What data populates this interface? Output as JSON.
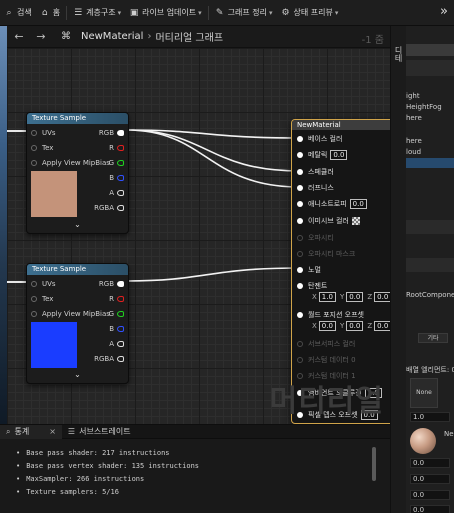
{
  "toolbar": {
    "search_label": "검색",
    "home_label": "홈",
    "hierarchy_label": "계층구조",
    "live_update_label": "라이브 업데이트",
    "graph_cleanup_label": "그래프 정리",
    "state_preview_label": "상태 프리뷰",
    "more_label": "»"
  },
  "graph_header": {
    "back_label": "←",
    "forward_label": "→",
    "material_name": "NewMaterial",
    "separator": "›",
    "graph_label": "머티리얼 그래프",
    "zoom_label": "-1 줌"
  },
  "texture_node_1": {
    "title": "Texture Sample",
    "inputs": [
      "UVs",
      "Tex",
      "Apply View MipBias"
    ],
    "outputs": [
      "RGB",
      "R",
      "G",
      "B",
      "A",
      "RGBA"
    ],
    "preview_color": "#c4937a"
  },
  "texture_node_2": {
    "title": "Texture Sample",
    "inputs": [
      "UVs",
      "Tex",
      "Apply View MipBias"
    ],
    "outputs": [
      "RGB",
      "R",
      "G",
      "B",
      "A",
      "RGBA"
    ],
    "preview_color": "#1a3dff"
  },
  "material_node": {
    "title": "NewMaterial",
    "base_color": "베이스 컬러",
    "metallic": "메탈릭",
    "metallic_value": "0.0",
    "specular": "스페큘러",
    "roughness": "러프니스",
    "anisotropy": "애니소트로피",
    "anisotropy_value": "0.0",
    "emissive": "이미시브 컬러",
    "opacity": "오파시티",
    "opacity_mask": "오파시티 마스크",
    "normal": "노멀",
    "tangent": "탄젠트",
    "tangent_x": "1.0",
    "tangent_y": "0.0",
    "tangent_z": "0.0",
    "wpo": "월드 포지션 오프셋",
    "wpo_x": "0.0",
    "wpo_y": "0.0",
    "wpo_z": "0.0",
    "subsurface": "서브서피스 컬러",
    "custom_data_0": "커스텀 데이터 0",
    "custom_data_1": "커스텀 데이터 1",
    "ambient_occlusion": "앰비언트 오클루전",
    "ambient_occlusion_value": "1.0",
    "pixel_depth_offset": "픽셀 뎁스 오프셋",
    "pixel_depth_offset_value": "0.0",
    "axis_x": "X",
    "axis_y": "Y",
    "axis_z": "Z"
  },
  "watermark": "머티리얼",
  "right_panel": {
    "tab_label": "디테",
    "items": [
      "ight",
      "HeightFog",
      "here",
      "here",
      "loud",
      "RootComponen",
      "배열 엘리먼트: 0"
    ],
    "other_button": "기타",
    "none_label": "None",
    "field_1": "1.0",
    "field_2": "0.0",
    "field_3": "0.0",
    "field_4": "0.0",
    "field_5": "0.0",
    "ne_label": "Ne"
  },
  "stats": {
    "tab_stats": "통계",
    "tab_substrate": "서브스트레이트",
    "lines": [
      "Base pass shader: 217 instructions",
      "Base pass vertex shader: 135 instructions",
      "MaxSampler: 266 instructions",
      "Texture samplers: 5/16"
    ]
  }
}
